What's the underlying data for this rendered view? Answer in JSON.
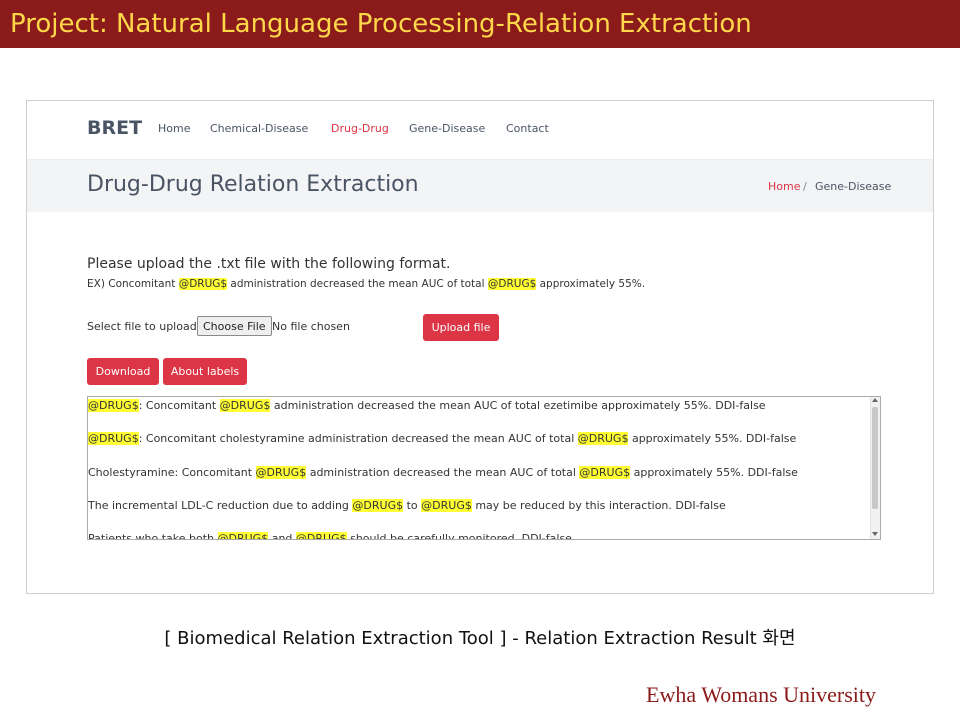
{
  "slide": {
    "title": "Project: Natural Language Processing-Relation Extraction",
    "caption": "[ Biomedical Relation Extraction Tool ] - Relation Extraction Result 화면",
    "footer": "Ewha Womans University"
  },
  "navbar": {
    "brand": "BRET",
    "items": [
      {
        "label": "Home"
      },
      {
        "label": "Chemical-Disease"
      },
      {
        "label": "Drug-Drug",
        "active": true
      },
      {
        "label": "Gene-Disease"
      },
      {
        "label": "Contact"
      }
    ]
  },
  "page": {
    "title": "Drug-Drug Relation Extraction",
    "breadcrumb": {
      "home": "Home",
      "separator": "/",
      "current": "Gene-Disease"
    }
  },
  "upload": {
    "instruction": "Please upload the .txt file with the following format.",
    "example_parts": [
      "EX) Concomitant ",
      "@DRUG$",
      " administration decreased the mean AUC of total ",
      "@DRUG$",
      " approximately 55%."
    ],
    "select_label": "Select file to upload:",
    "choose_button": "Choose File",
    "no_file": "No file chosen",
    "upload_button": "Upload file"
  },
  "actions": {
    "download": "Download",
    "about": "About labels"
  },
  "results": [
    [
      "@DRUG$",
      ": Concomitant ",
      "@DRUG$",
      " administration decreased the mean AUC of total ezetimibe approximately 55%. DDI-false"
    ],
    [
      "@DRUG$",
      ": Concomitant cholestyramine administration decreased the mean AUC of total ",
      "@DRUG$",
      " approximately 55%. DDI-false"
    ],
    [
      "Cholestyramine: Concomitant ",
      "@DRUG$",
      " administration decreased the mean AUC of total ",
      "@DRUG$",
      " approximately 55%. DDI-false"
    ],
    [
      "The incremental LDL-C reduction due to adding ",
      "@DRUG$",
      " to ",
      "@DRUG$",
      " may be reduced by this interaction. DDI-false"
    ],
    [
      "Patients who take both ",
      "@DRUG$",
      " and ",
      "@DRUG$",
      " should be carefully monitored. DDI-false"
    ]
  ],
  "colors": {
    "header_bg": "#8b1a1a",
    "header_text": "#ffd84a",
    "accent": "#dc3545",
    "highlight": "#ffff33"
  }
}
